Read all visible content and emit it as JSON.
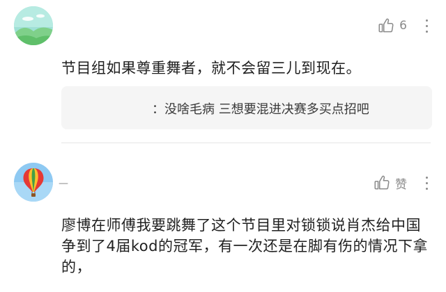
{
  "comments": [
    {
      "username": "",
      "like_label": "6",
      "text": "节目组如果尊重舞者，就不会留三儿到现在。",
      "reply": {
        "text": "：没啥毛病 三想要混进决赛多买点招吧"
      }
    },
    {
      "username": "—",
      "like_label": "赞",
      "text": "廖博在师傅我要跳舞了这个节目里对锁锁说肖杰给中国争到了4届kod的冠军，有一次还是在脚有伤的情况下拿的，"
    }
  ],
  "colors": {
    "meta_gray": "#8a8a8a",
    "reply_bg": "#f5f5f5",
    "divider": "#e6e6e6"
  },
  "icons": {
    "like": "thumbs-up-icon",
    "more": "more-vertical-icon",
    "avatar1": "landscape-avatar",
    "avatar2": "hot-air-balloon-avatar"
  }
}
